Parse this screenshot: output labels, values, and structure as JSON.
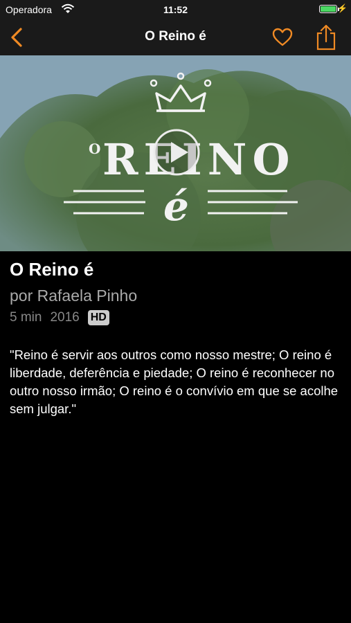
{
  "status_bar": {
    "carrier": "Operadora",
    "time": "11:52"
  },
  "nav": {
    "title": "O Reino é",
    "back_icon": "chevron-left-icon",
    "favorite_icon": "heart-icon",
    "share_icon": "share-icon",
    "accent_color": "#f08a24"
  },
  "hero": {
    "overlay_text_top": "O",
    "overlay_text_main": "REINO",
    "overlay_text_sub": "é",
    "play_icon": "play-icon"
  },
  "video": {
    "title": "O Reino é",
    "author": "por Rafaela Pinho",
    "duration": "5 min",
    "year": "2016",
    "quality_badge": "HD",
    "description": "\"Reino é servir aos outros como nosso mestre; O reino é liberdade, deferência e piedade; O reino é reconhecer no outro nosso irmão; O reino é o convívio em que se acolhe sem julgar.\""
  }
}
